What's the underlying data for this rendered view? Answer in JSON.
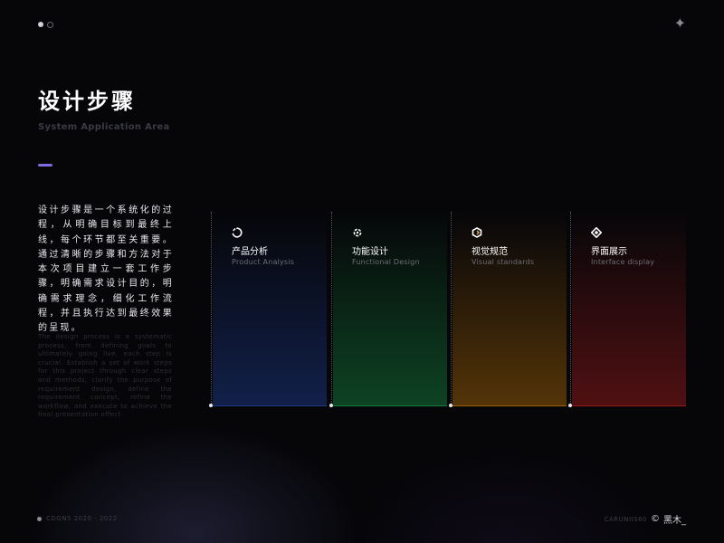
{
  "page": {
    "title": "设计步骤",
    "subtitle": "System Application Area",
    "accent_color": "#7e6de0"
  },
  "description": {
    "zh": "设计步骤是一个系统化的过程，从明确目标到最终上线，每个环节都至关重要。通过清晰的步骤和方法对于本次项目建立一套工作步骤，明确需求设计目的，明确需求理念，细化工作流程，并且执行达到最终效果的呈现。",
    "en": "The design process is a systematic process, from defining goals to ultimately going live, each step is crucial. Establish a set of work steps for this project through clear steps and methods, clarify the purpose of requirement design, define the requirement concept, refine the workflow, and execute to achieve the final presentation effect."
  },
  "steps": [
    {
      "cn": "产品分析",
      "en": "Product Analysis",
      "color": "#1e3a8a",
      "icon": "circle-arc-icon"
    },
    {
      "cn": "功能设计",
      "en": "Functional Design",
      "color": "#15803d",
      "icon": "gear-icon"
    },
    {
      "cn": "视觉规范",
      "en": "Visual standards",
      "color": "#a16207",
      "icon": "hexagon-icon"
    },
    {
      "cn": "界面展示",
      "en": "Interface display",
      "color": "#991b1b",
      "icon": "diamond-icon"
    }
  ],
  "footer": {
    "left_text": "CDGNS 2020 - 2022",
    "right_text": "CARUNIIS60",
    "copyright": "©",
    "author": "黑木_"
  }
}
